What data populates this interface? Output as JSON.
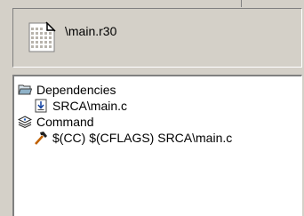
{
  "header": {
    "label": "\\main.r30",
    "icon": "dotted-grid-document-icon"
  },
  "tree": {
    "items": [
      {
        "label": "Dependencies",
        "icon": "open-folder-icon"
      },
      {
        "label": "SRCA\\main.c",
        "icon": "source-file-icon"
      },
      {
        "label": "Command",
        "icon": "command-stack-icon"
      },
      {
        "label": "$(CC) $(CFLAGS) SRCA\\main.c",
        "icon": "hammer-icon"
      }
    ]
  },
  "colors": {
    "window_bg": "#d4d0c8",
    "tree_bg": "#ffffff",
    "shadow": "#808080",
    "folder": "#8fb2c8",
    "hammer_handle": "#c06000"
  }
}
